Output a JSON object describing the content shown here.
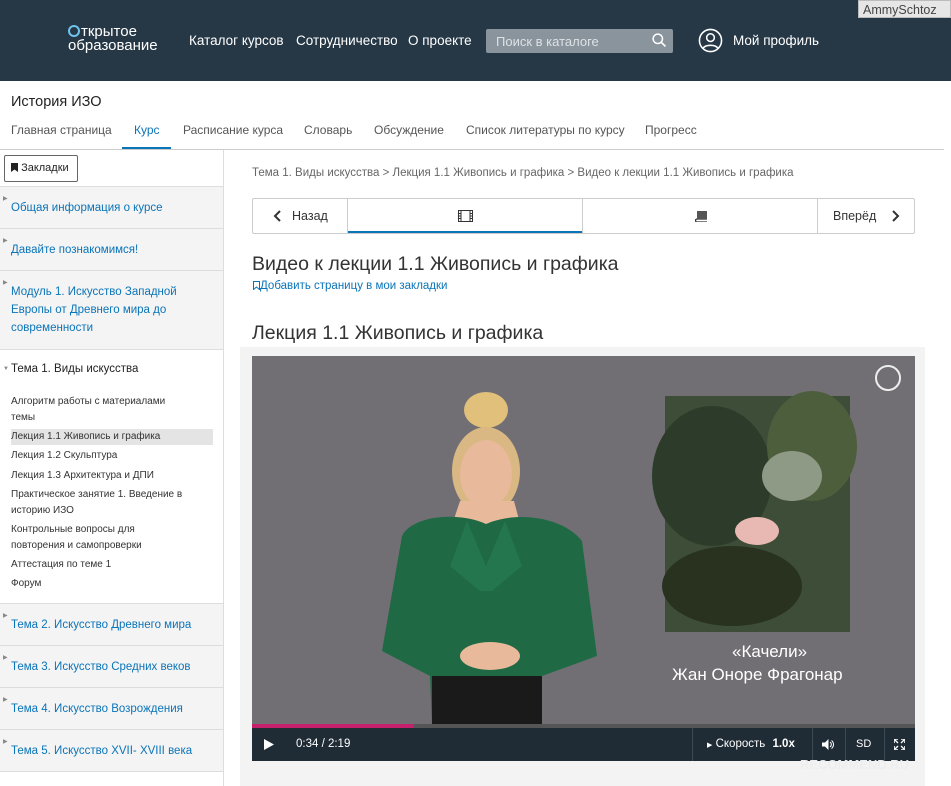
{
  "header": {
    "logo_line1": "ткрытое",
    "logo_line2": "образование",
    "nav": [
      "Каталог курсов",
      "Сотрудничество",
      "О проекте"
    ],
    "search_placeholder": "Поиск в каталоге",
    "profile_label": "Мой профиль",
    "username": "AmmySchtoz"
  },
  "course": {
    "title": "История ИЗО",
    "tabs": [
      "Главная страница",
      "Курс",
      "Расписание курса",
      "Словарь",
      "Обсуждение",
      "Список литературы по курсу",
      "Прогресс"
    ],
    "active_tab": "Курс"
  },
  "sidebar": {
    "bookmarks_label": "Закладки",
    "sections": [
      {
        "label": "Общая информация о курсе"
      },
      {
        "label": "Давайте познакомимся!"
      },
      {
        "label": "Модуль 1. Искусство Западной"
      },
      {
        "label": "Европы от Древнего мира до"
      },
      {
        "label": "современности"
      }
    ],
    "open_section": {
      "title": "Тема 1. Виды искусства",
      "items": [
        "Алгоритм работы с материалами",
        "темы",
        "Лекция 1.1 Живопись и графика",
        "Лекция 1.2 Скульптура",
        "Лекция 1.3 Архитектура и ДПИ",
        "Практическое занятие 1. Введение в",
        "историю ИЗО",
        "Контрольные вопросы для",
        "повторения и самопроверки",
        "Аттестация по теме 1",
        "Форум"
      ]
    },
    "more_sections": [
      "Тема 2. Искусство Древнего мира",
      "Тема 3. Искусство Средних веков",
      "Тема 4. Искусство Возрождения",
      "Тема 5. Искусство XVII- XVIII века"
    ]
  },
  "main": {
    "breadcrumb": "Тема 1. Виды искусства > Лекция 1.1 Живопись и графика > Видео к лекции 1.1 Живопись и графика",
    "prev_label": "Назад",
    "next_label": "Вперёд",
    "page_title": "Видео к лекции 1.1 Живопись и графика",
    "add_bookmark": "Добавить страницу в мои закладки",
    "lecture_title": "Лекция 1.1 Живопись и графика"
  },
  "video": {
    "caption_title": "«Качели»",
    "caption_author": "Жан Оноре Фрагонар",
    "time": "0:34 / 2:19",
    "progress": 0.245,
    "speed_label": "Скорость",
    "speed_value": "1.0x",
    "quality": "SD",
    "accent_color": "#c5206c"
  },
  "watermark": "RECOMMEND.RU"
}
